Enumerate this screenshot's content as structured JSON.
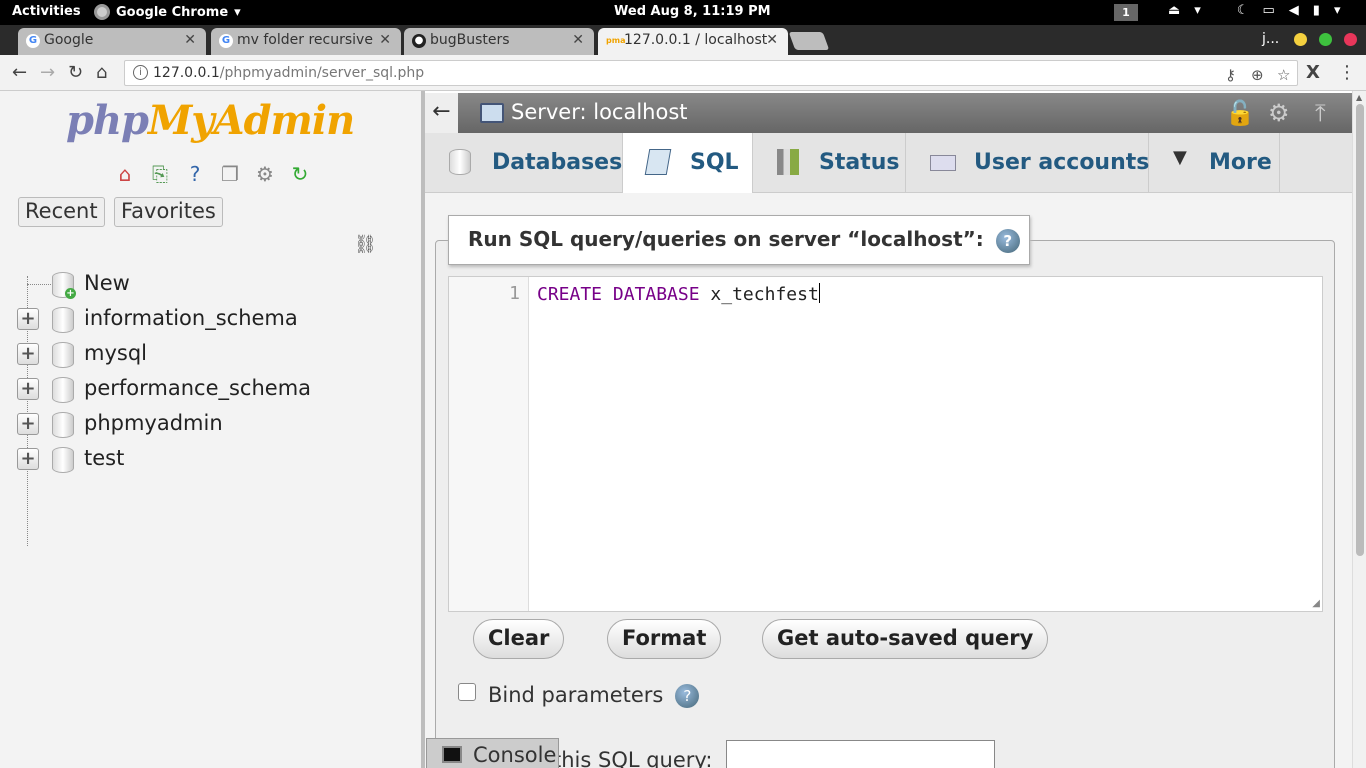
{
  "topbar": {
    "activities": "Activities",
    "app_name": "Google Chrome",
    "clock": "Wed Aug  8, 11:19 PM",
    "workspace": "1"
  },
  "browser": {
    "tabs": [
      {
        "title": "Google"
      },
      {
        "title": "mv folder recursive"
      },
      {
        "title": "bugBusters"
      },
      {
        "title": "127.0.0.1 / localhost"
      }
    ],
    "profile": "j...",
    "url_host": "127.0.0.1",
    "url_path": "/phpmyadmin/server_sql.php"
  },
  "sidebar": {
    "logo_php": "php",
    "logo_myadmin": "MyAdmin",
    "recent_label": "Recent",
    "favorites_label": "Favorites",
    "databases": [
      {
        "name": "New"
      },
      {
        "name": "information_schema"
      },
      {
        "name": "mysql"
      },
      {
        "name": "performance_schema"
      },
      {
        "name": "phpmyadmin"
      },
      {
        "name": "test"
      }
    ]
  },
  "server": {
    "title": "Server: localhost"
  },
  "tabs": [
    {
      "label": "Databases"
    },
    {
      "label": "SQL"
    },
    {
      "label": "Status"
    },
    {
      "label": "User accounts"
    },
    {
      "label": "More"
    }
  ],
  "sql_panel": {
    "legend": "Run SQL query/queries on server “localhost”:",
    "line_number": "1",
    "code_keyword1": "CREATE",
    "code_keyword2": "DATABASE",
    "code_name": "x_techfest",
    "clear_label": "Clear",
    "format_label": "Format",
    "autosave_label": "Get auto-saved query",
    "bind_label": "Bind parameters",
    "delimiter_label_partial": "this SQL query:"
  },
  "console": {
    "label": "Console"
  },
  "colors": {
    "accent": "#235a81",
    "keyword": "#770088",
    "logo_php": "#7b7fb5",
    "logo_myadmin": "#f0a300"
  }
}
